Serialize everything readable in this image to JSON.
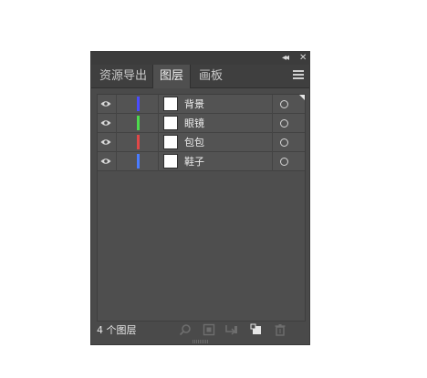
{
  "panel": {
    "titlebar": {
      "collapse_glyph": "◂◂",
      "close_glyph": "✕"
    },
    "tabs": [
      {
        "label": "资源导出",
        "active": false
      },
      {
        "label": "图层",
        "active": true
      },
      {
        "label": "画板",
        "active": false
      }
    ],
    "menu_icon": "hamburger-menu-icon",
    "layers": [
      {
        "name": "背景",
        "color": "#4a4cff"
      },
      {
        "name": "眼镜",
        "color": "#4ddb4d"
      },
      {
        "name": "包包",
        "color": "#e04848"
      },
      {
        "name": "鞋子",
        "color": "#4a7cff"
      }
    ],
    "footer": {
      "count_text": "4 个图层",
      "icons": [
        "search-icon",
        "make-clipping-mask-icon",
        "create-sublayer-icon",
        "new-layer-icon",
        "delete-icon"
      ]
    }
  }
}
